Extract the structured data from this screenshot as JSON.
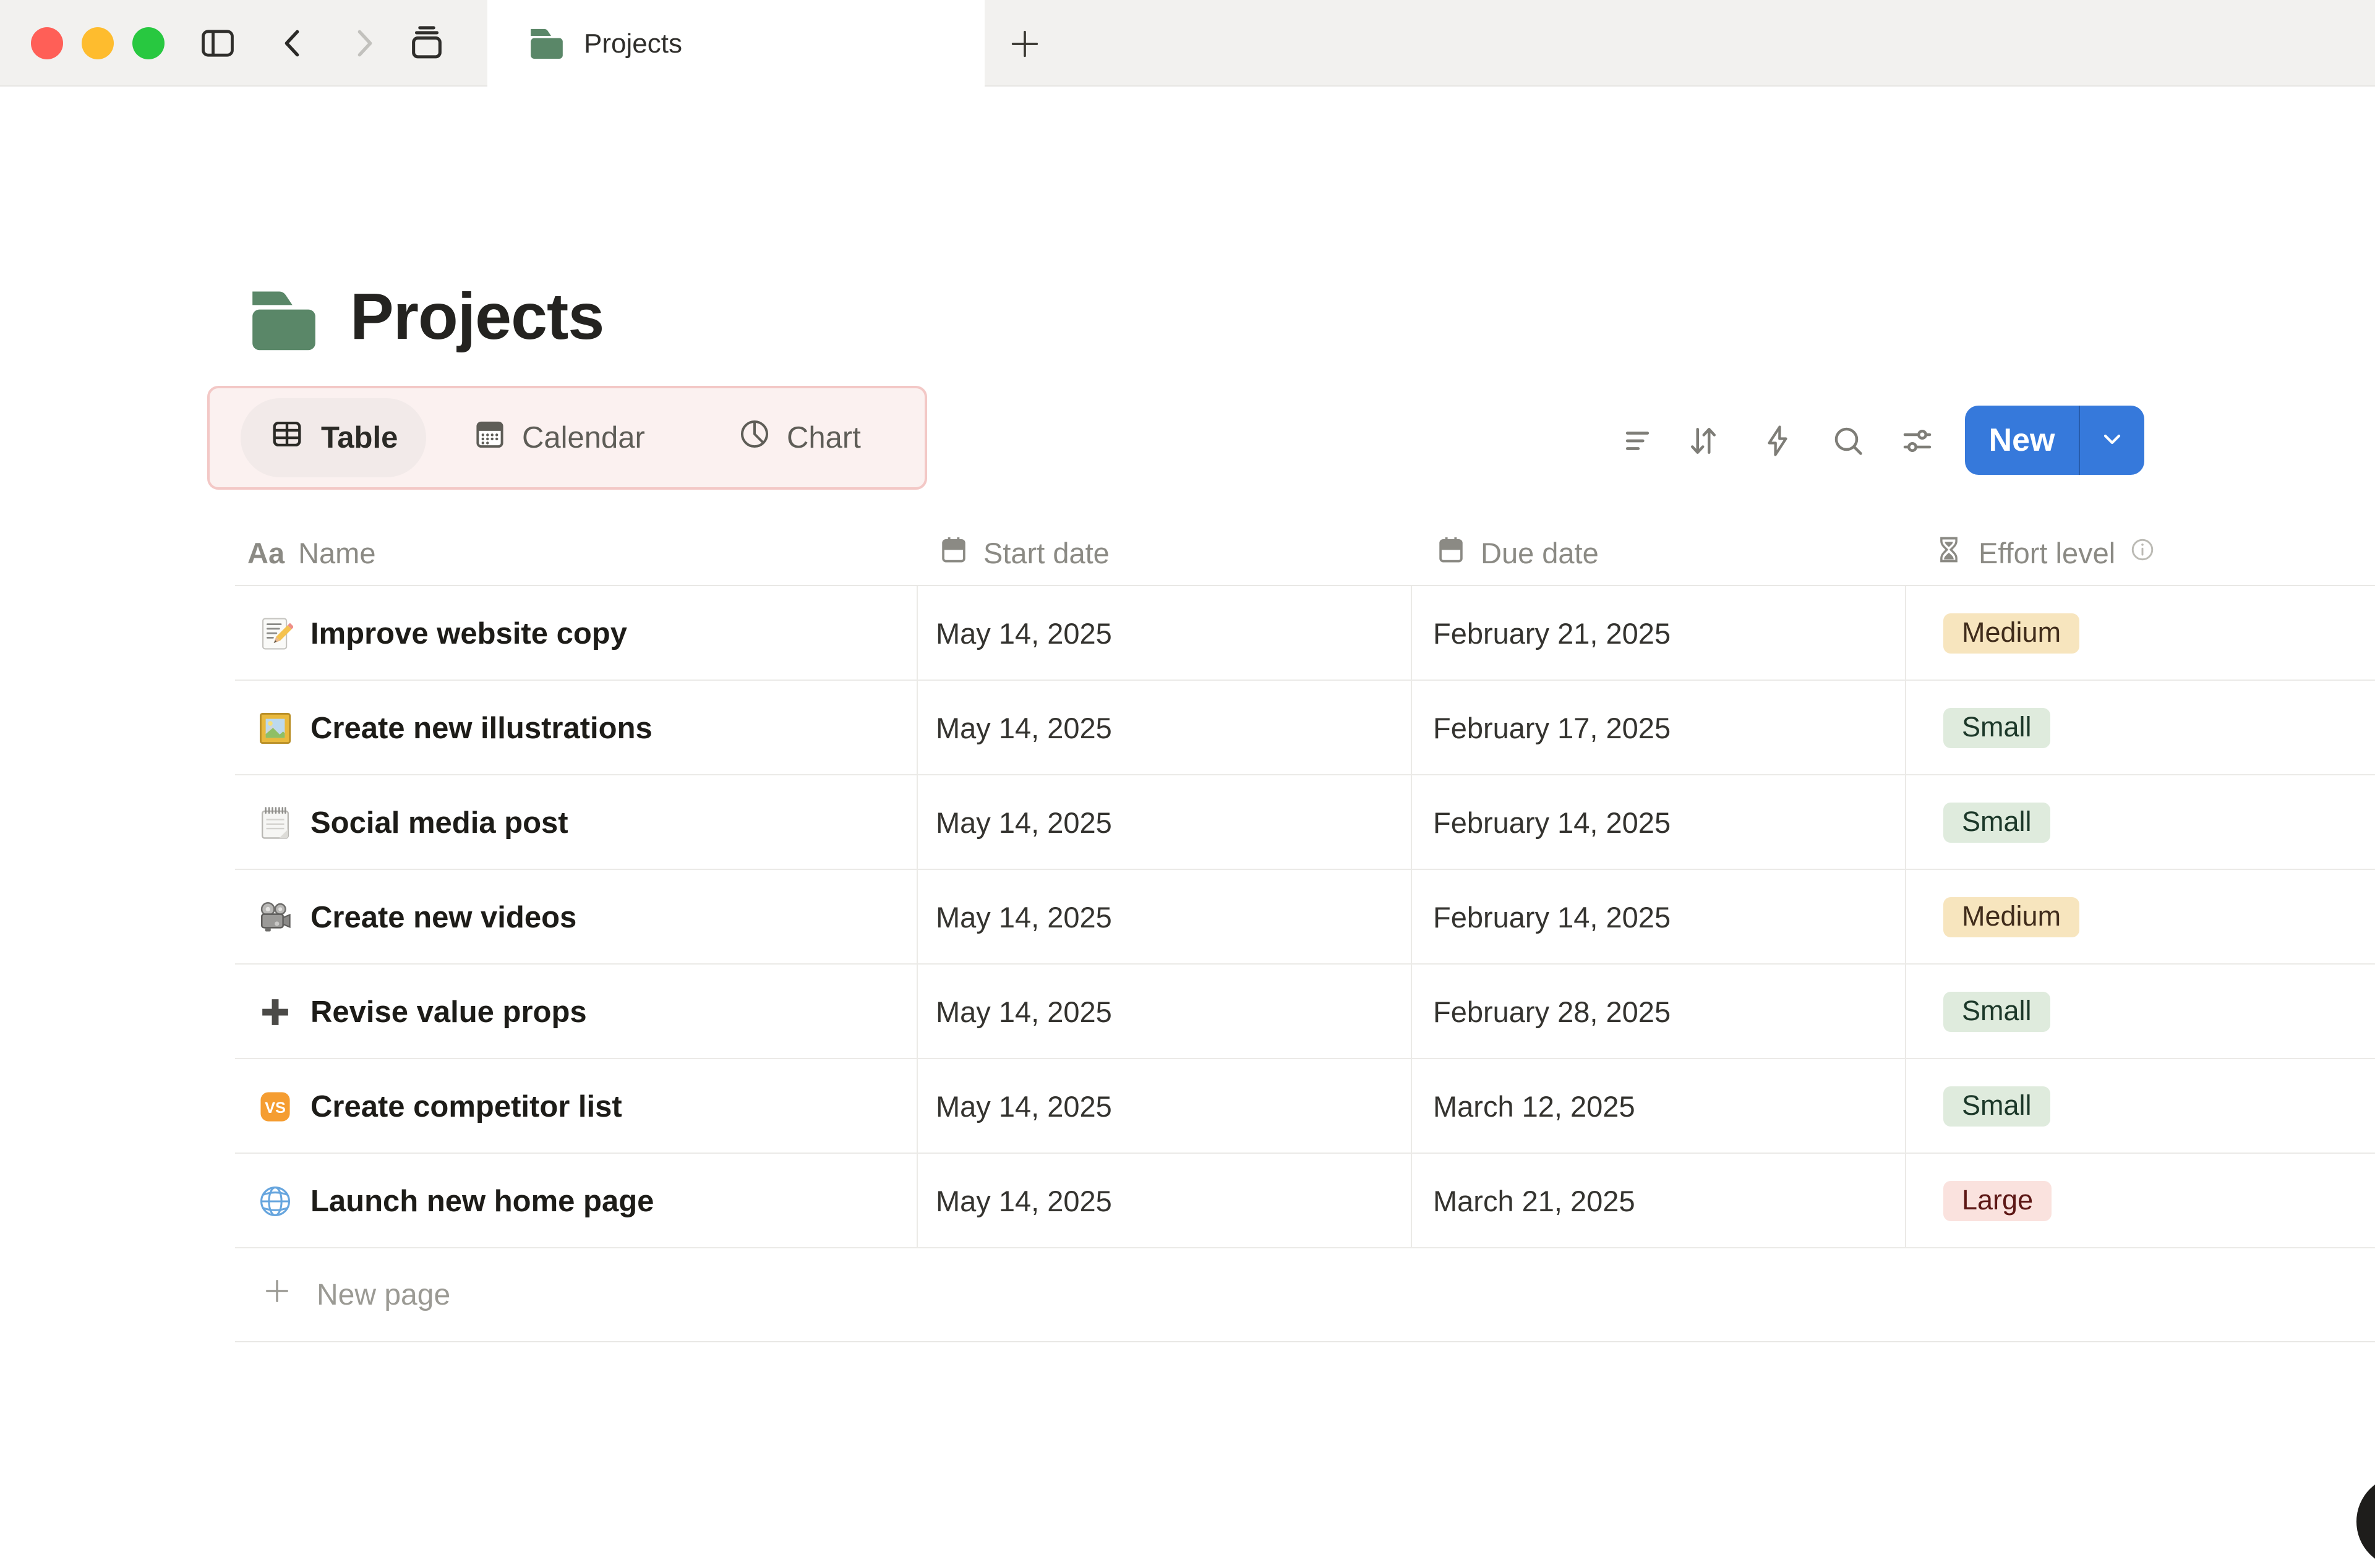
{
  "titlebar": {
    "window_controls": [
      "close",
      "minimize",
      "zoom"
    ],
    "nav_icons": [
      "sidebar-toggle-icon",
      "back-icon",
      "forward-icon",
      "tab-overview-icon"
    ],
    "tab": {
      "icon": "green-folder-emoji",
      "label": "Projects"
    },
    "new_tab_icon": "plus-icon"
  },
  "page": {
    "icon": "green-folder-emoji",
    "title": "Projects"
  },
  "views": {
    "items": [
      {
        "label": "Table",
        "icon": "table-icon",
        "active": true
      },
      {
        "label": "Calendar",
        "icon": "calendar-icon",
        "active": false
      },
      {
        "label": "Chart",
        "icon": "pie-chart-icon",
        "active": false
      }
    ]
  },
  "actions": {
    "icons": [
      "filter-icon",
      "sort-icon",
      "automation-bolt-icon",
      "search-icon",
      "view-options-icon"
    ],
    "new_button": {
      "label": "New",
      "dropdown_icon": "chevron-down-icon"
    }
  },
  "table": {
    "headers": {
      "name": {
        "label": "Name",
        "icon_text": "Aa"
      },
      "start": {
        "label": "Start date",
        "icon": "calendar-icon"
      },
      "due": {
        "label": "Due date",
        "icon": "calendar-icon"
      },
      "effort": {
        "label": "Effort level",
        "icon": "hourglass-icon",
        "info_icon": "info-circle-icon"
      }
    },
    "rows": [
      {
        "icon": "memo-emoji",
        "name": "Improve website copy",
        "start": "May 14, 2025",
        "due": "February 21, 2025",
        "effort": "Medium",
        "effort_color": "yellow"
      },
      {
        "icon": "framed-picture-emoji",
        "name": "Create new illustrations",
        "start": "May 14, 2025",
        "due": "February 17, 2025",
        "effort": "Small",
        "effort_color": "green"
      },
      {
        "icon": "spiral-notepad-emoji",
        "name": "Social media post",
        "start": "May 14, 2025",
        "due": "February 14, 2025",
        "effort": "Small",
        "effort_color": "green"
      },
      {
        "icon": "film-projector-emoji",
        "name": "Create new videos",
        "start": "May 14, 2025",
        "due": "February 14, 2025",
        "effort": "Medium",
        "effort_color": "yellow"
      },
      {
        "icon": "heavy-plus-emoji",
        "name": "Revise value props",
        "start": "May 14, 2025",
        "due": "February 28, 2025",
        "effort": "Small",
        "effort_color": "green"
      },
      {
        "icon": "vs-badge-emoji",
        "name": "Create competitor list",
        "start": "May 14, 2025",
        "due": "March 12, 2025",
        "effort": "Small",
        "effort_color": "green"
      },
      {
        "icon": "globe-emoji",
        "name": "Launch new home page",
        "start": "May 14, 2025",
        "due": "March 21, 2025",
        "effort": "Large",
        "effort_color": "red"
      }
    ],
    "new_page_label": "New page"
  },
  "colors": {
    "accent_blue": "#3679db",
    "highlight_box_bg": "#fbf1f0",
    "highlight_box_border": "#f3c8c6",
    "chip_yellow_bg": "#f7e5be",
    "chip_green_bg": "#dfebdd",
    "chip_red_bg": "#fae2de",
    "traffic_red": "#ff5f57",
    "traffic_yellow": "#febc2e",
    "traffic_green": "#28c840"
  }
}
